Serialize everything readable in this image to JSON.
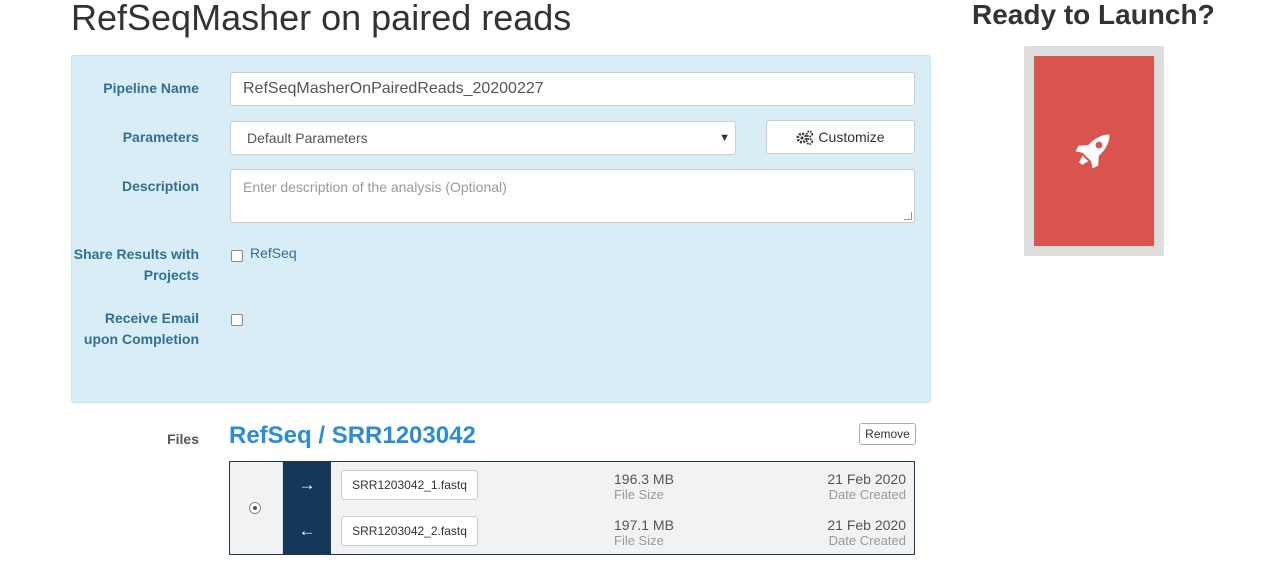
{
  "page": {
    "title": "RefSeqMasher on paired reads"
  },
  "form": {
    "pipeline_name_label": "Pipeline Name",
    "pipeline_name_value": "RefSeqMasherOnPairedReads_20200227",
    "parameters_label": "Parameters",
    "parameters_value": "Default Parameters",
    "customize_label": "Customize",
    "description_label": "Description",
    "description_placeholder": "Enter description of the analysis (Optional)",
    "share_label": "Share Results with Projects",
    "share_option": "RefSeq",
    "share_checked": false,
    "email_label": "Receive Email upon Completion",
    "email_checked": false
  },
  "files": {
    "label": "Files",
    "heading": "RefSeq / SRR1203042",
    "remove_label": "Remove",
    "items": [
      {
        "direction": "forward",
        "name": "SRR1203042_1.fastq",
        "size": "196.3 MB",
        "size_label": "File Size",
        "date": "21 Feb 2020",
        "date_label": "Date Created"
      },
      {
        "direction": "reverse",
        "name": "SRR1203042_2.fastq",
        "size": "197.1 MB",
        "size_label": "File Size",
        "date": "21 Feb 2020",
        "date_label": "Date Created"
      }
    ]
  },
  "launch": {
    "title": "Ready to Launch?",
    "icon": "rocket-icon"
  },
  "colors": {
    "panel_bg": "#d9edf7",
    "label_text": "#31708f",
    "launch_button": "#d9534f",
    "direction_bg": "#14375a",
    "link": "#2b8cd7"
  }
}
